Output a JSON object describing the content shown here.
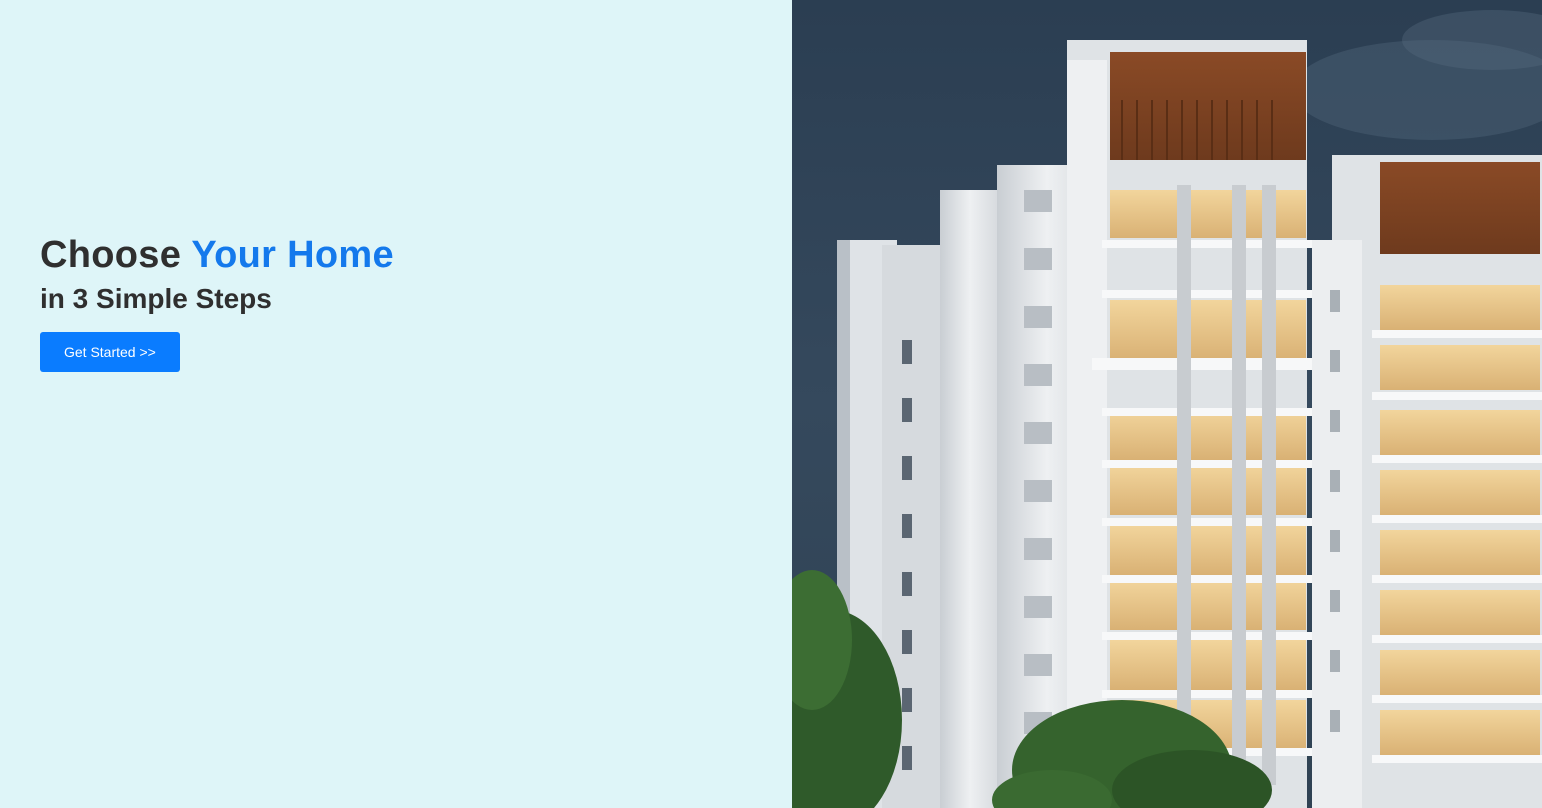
{
  "hero": {
    "headline_part1": "Choose ",
    "headline_accent": "Your Home",
    "subheadline": "in 3 Simple Steps",
    "cta_label": "Get Started >>"
  },
  "colors": {
    "left_background": "#def5f8",
    "accent": "#1479ec",
    "button": "#0a7cff",
    "text": "#2f2f2f"
  },
  "image": {
    "subject": "high-rise residential apartment towers at dusk"
  }
}
